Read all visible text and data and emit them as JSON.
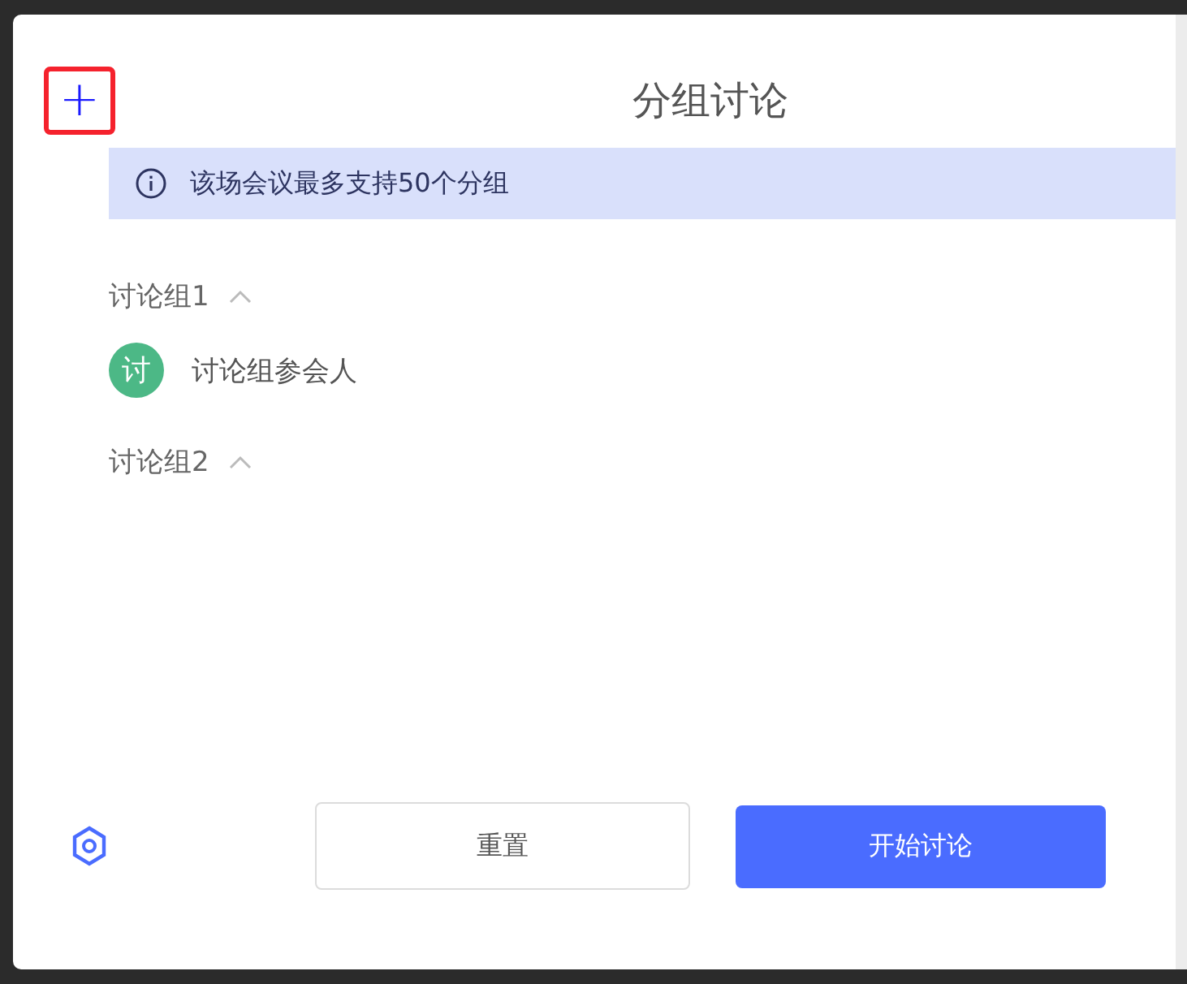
{
  "add_button": {
    "label": "+",
    "highlighted": true
  },
  "title": "分组讨论",
  "notice": {
    "text": "该场会议最多支持50个分组"
  },
  "groups": [
    {
      "name": "讨论组1",
      "expanded": true,
      "members": [
        {
          "avatar": "讨",
          "name": "讨论组参会人"
        }
      ]
    },
    {
      "name": "讨论组2",
      "expanded": true
    }
  ],
  "buttons": [
    {
      "label": "重置",
      "kind": "secondary"
    },
    {
      "label": "开始讨论",
      "kind": "primary"
    }
  ]
}
